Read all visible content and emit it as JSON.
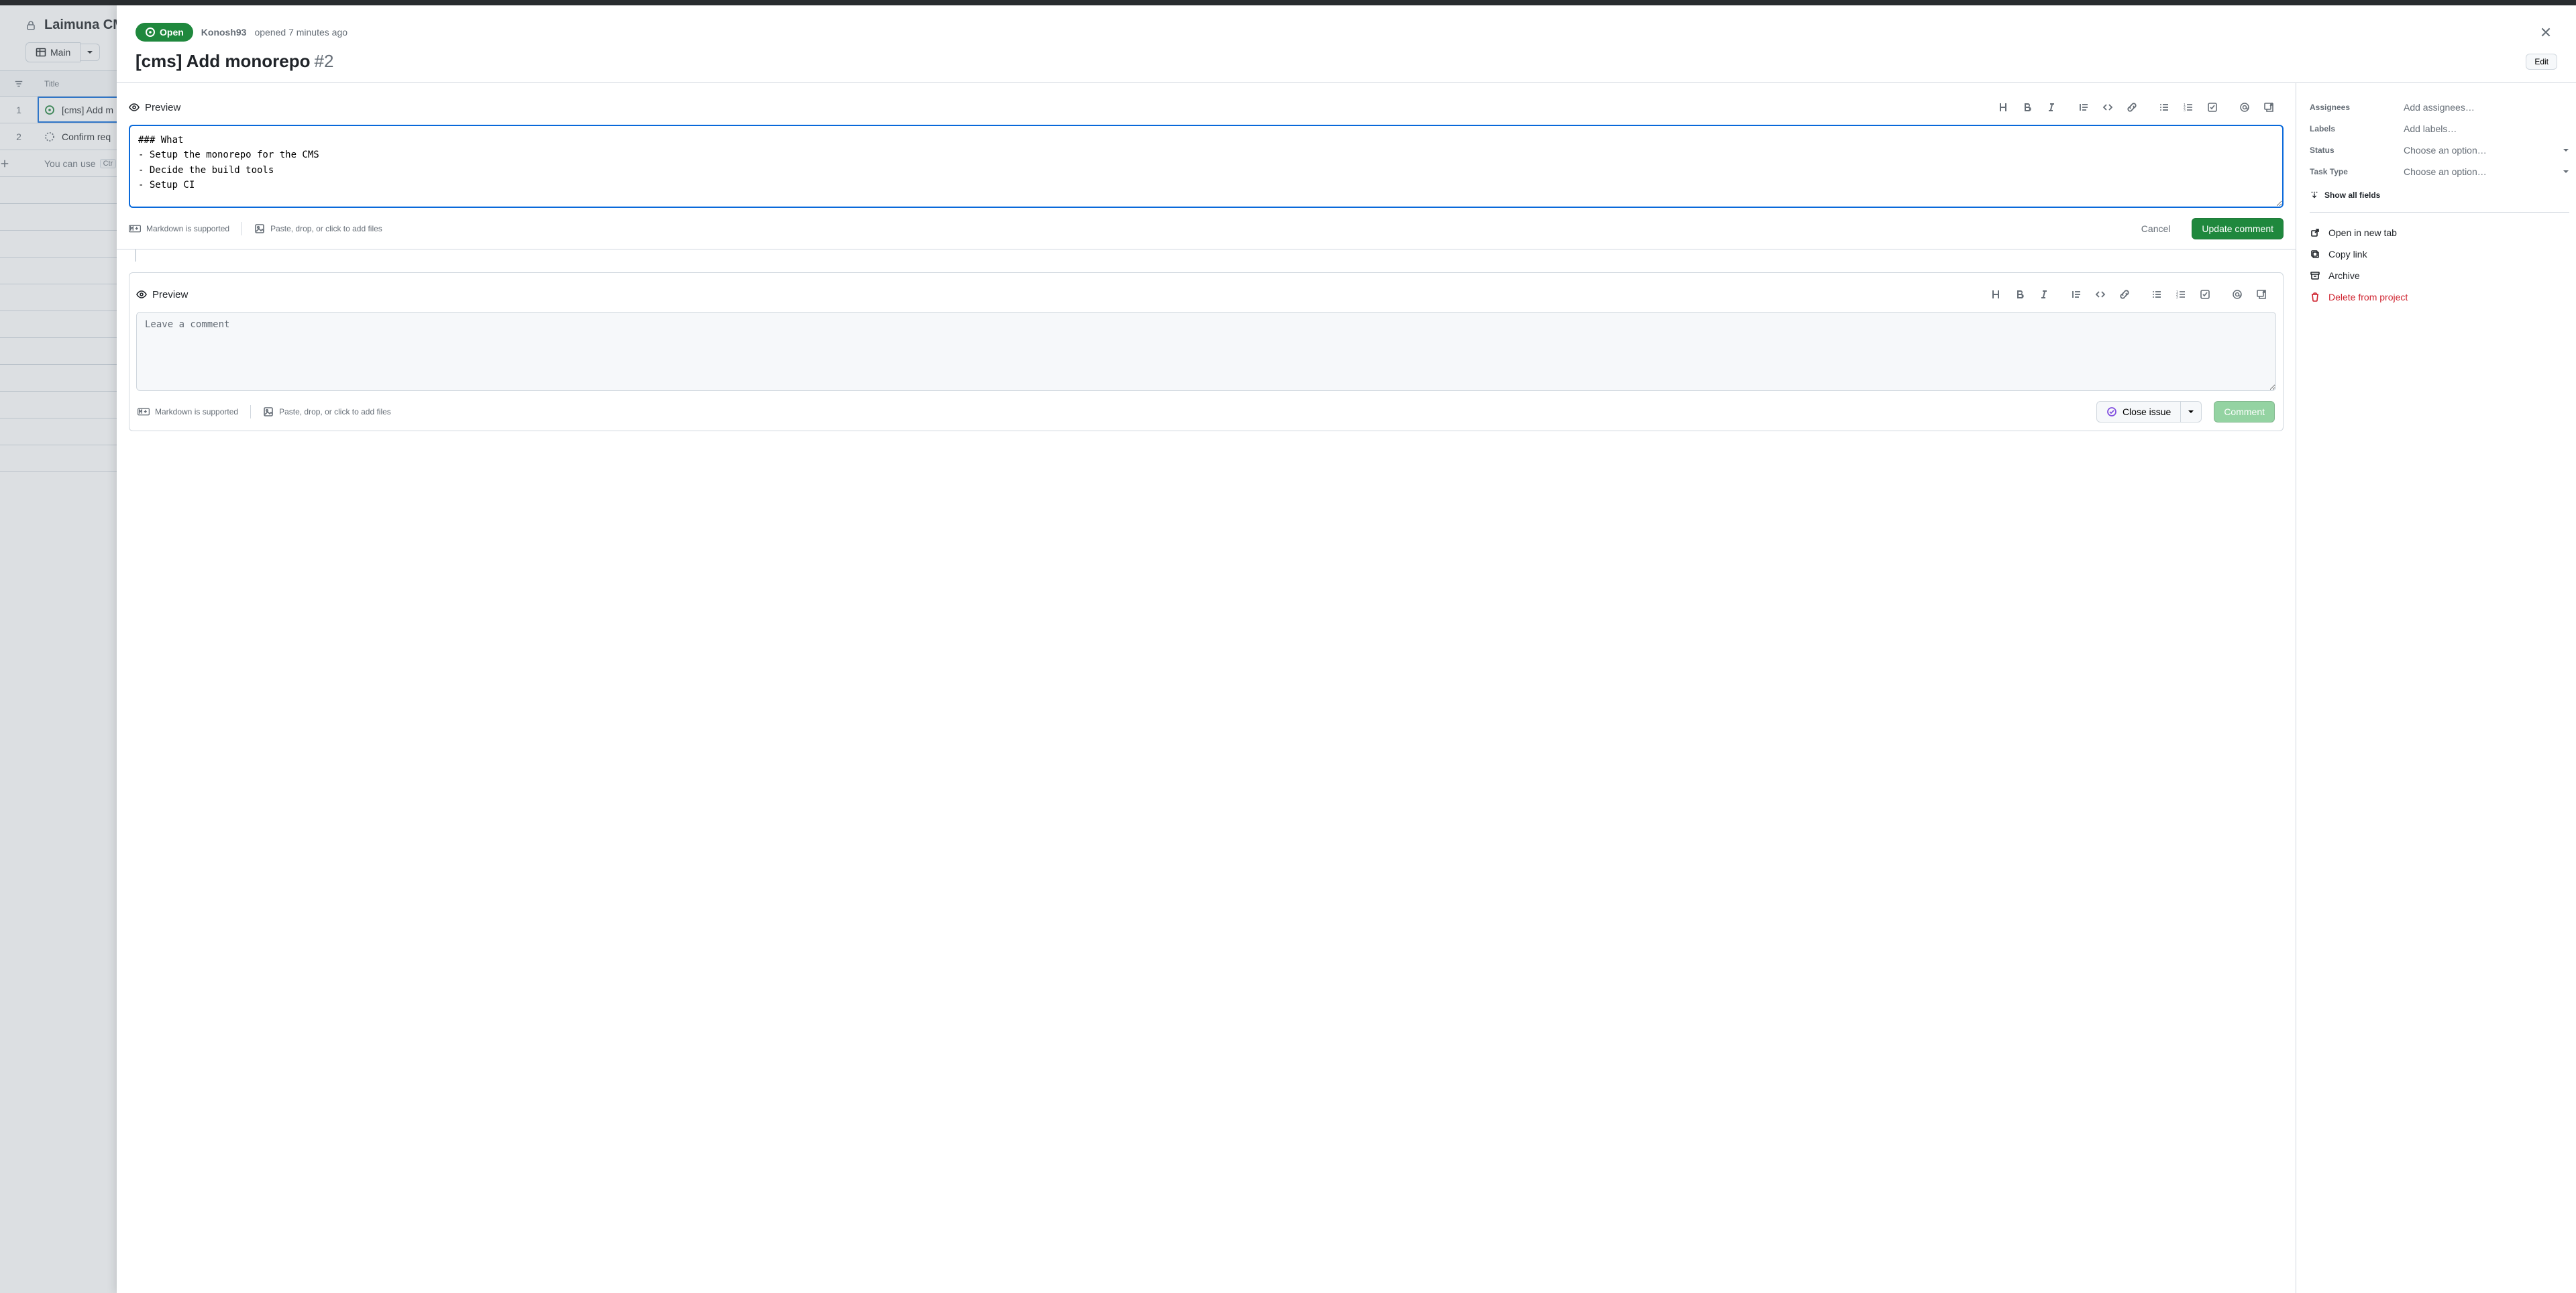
{
  "project": {
    "name": "Laimuna CM",
    "tab": "Main",
    "title_col": "Title",
    "rows": [
      {
        "num": "1",
        "kind": "issue",
        "title": "[cms] Add m"
      },
      {
        "num": "2",
        "kind": "draft",
        "title": "Confirm req"
      }
    ],
    "hint_prefix": "You can use",
    "hint_kbd": "Ctr"
  },
  "issue": {
    "state": "Open",
    "author": "Konosh93",
    "opened": "opened 7 minutes ago",
    "title": "[cms] Add monorepo",
    "number": "#2",
    "edit": "Edit",
    "body": "### What\n- Setup the monorepo for the CMS\n- Decide the build tools\n- Setup CI"
  },
  "editor": {
    "preview": "Preview",
    "md_hint": "Markdown is supported",
    "attach_hint": "Paste, drop, or click to add files",
    "cancel": "Cancel",
    "update": "Update comment",
    "comment_placeholder": "Leave a comment",
    "close_issue": "Close issue",
    "comment": "Comment"
  },
  "side": {
    "assignees": {
      "label": "Assignees",
      "value": "Add assignees…"
    },
    "labels": {
      "label": "Labels",
      "value": "Add labels…"
    },
    "status": {
      "label": "Status",
      "value": "Choose an option…"
    },
    "task_type": {
      "label": "Task Type",
      "value": "Choose an option…"
    },
    "show_all": "Show all fields",
    "open_tab": "Open in new tab",
    "copy_link": "Copy link",
    "archive": "Archive",
    "delete": "Delete from project"
  }
}
